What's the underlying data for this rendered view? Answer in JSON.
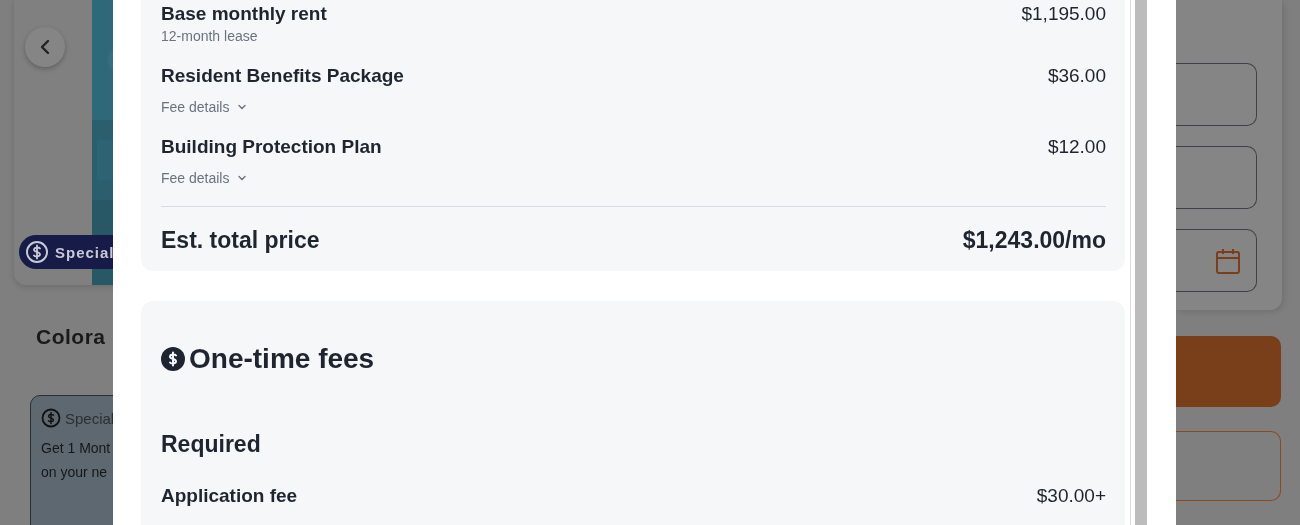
{
  "background": {
    "badge": "Special",
    "heading": "Colora",
    "offer": {
      "title": "Special",
      "lines": [
        "Get 1 Mont",
        "on your ne"
      ]
    }
  },
  "monthly_fees": {
    "items": [
      {
        "kind": "note",
        "name": "Base monthly rent",
        "price": "$1,195.00",
        "sub": "12-month lease"
      },
      {
        "kind": "details",
        "name": "Resident Benefits Package",
        "price": "$36.00",
        "sub": "Fee details"
      },
      {
        "kind": "details",
        "name": "Building Protection Plan",
        "price": "$12.00",
        "sub": "Fee details"
      }
    ],
    "total": {
      "label": "Est. total price",
      "value": "$1,243.00/mo"
    }
  },
  "one_time_fees": {
    "title": "One-time fees",
    "section": "Required",
    "items": [
      {
        "name": "Application fee",
        "price": "$30.00+"
      }
    ]
  }
}
